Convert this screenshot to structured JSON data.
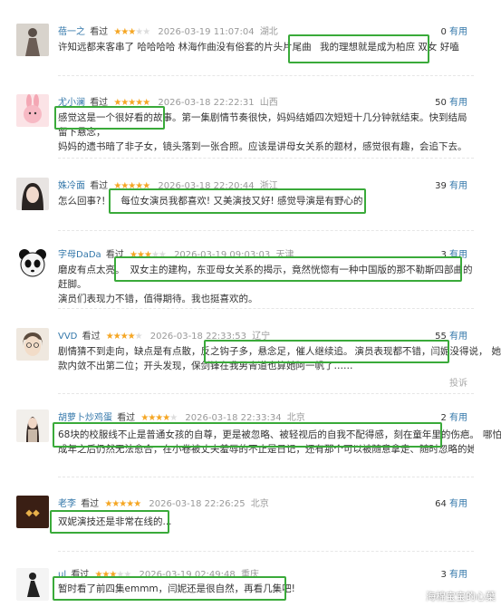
{
  "reviews": [
    {
      "user": "蓓一之",
      "watched": "看过",
      "rating": 3,
      "time": "2026-03-19 11:07:04",
      "location": "湖北",
      "useful_count": "0",
      "useful_label": "有用",
      "line1": "许知远都来客串了 哈哈哈哈 林海作曲没有俗套的片头片尾曲",
      "highlight": "我的理想就是成为柏庶 双女 好嗑"
    },
    {
      "user": "尤小澜",
      "watched": "看过",
      "rating": 5,
      "time": "2026-03-18 22:22:31",
      "location": "山西",
      "useful_count": "50",
      "useful_label": "有用",
      "highlight": "感觉这是一个很好看的故事。",
      "line1": "第一集剧情节奏很快，妈妈结婚四次短短十几分钟就结束。快到结局留下悬念，",
      "line2": "妈妈的遗书暗了非子女，镜头落到一张合照。应该是讲母女关系的题材，感觉很有趣，会追下去。"
    },
    {
      "user": "姝冷面",
      "watched": "看过",
      "rating": 5,
      "time": "2026-03-18 22:20:44",
      "location": "浙江",
      "useful_count": "39",
      "useful_label": "有用",
      "line1": "怎么回事?！",
      "highlight": "每位女演员我都喜欢! 又美演技又好! 感觉导演是有野心的!"
    },
    {
      "user": "字母DaDa",
      "watched": "看过",
      "rating": 3,
      "time": "2026-03-19 09:03:03",
      "location": "天津",
      "useful_count": "3",
      "useful_label": "有用",
      "line1": "磨皮有点太亮。",
      "highlight": "双女主的建构，东亚母女关系的揭示，竟然恍惚有一种中国版的那不勒斯四部曲的赶脚。",
      "line2": "演员们表现力不错，值得期待。我也挺喜欢的。"
    },
    {
      "user": "VVD",
      "watched": "看过",
      "rating": 4,
      "time": "2026-03-18 22:33:53",
      "location": "辽宁",
      "useful_count": "55",
      "useful_label": "有用",
      "line1": "剧情猜不到走向，缺点是有点散，反之钩子多，悬念足，催人继续追。",
      "highlight": "演员表现都不错，闫妮没得说，",
      "line1_tail": "她这",
      "line2": "款内敛不出第二位；开头发现，保剑锋在我男青道也算她阿一帆了……",
      "report": "投诉"
    },
    {
      "user": "胡萝卜炒鸡蛋",
      "watched": "看过",
      "rating": 4,
      "time": "2026-03-18 22:33:34",
      "location": "北京",
      "useful_count": "2",
      "useful_label": "有用",
      "highlight": "68块的校服线不止是普通女孩的自尊，更是被忽略、被轻视后的自我不配得感，刻在童年里的伤疤。",
      "tail": "哪怕",
      "line2": "成年之后仍然无法愈合，在小卷被丈夫羞辱的不止是日记，还有那个可以被随意拿走、随时忽略的她自己"
    },
    {
      "user": "老李",
      "watched": "看过",
      "rating": 5,
      "time": "2026-03-18 22:26:25",
      "location": "北京",
      "useful_count": "64",
      "useful_label": "有用",
      "highlight": "双妮演技还是非常在线的..."
    },
    {
      "user": "ul",
      "watched": "看过",
      "rating": 3,
      "time": "2026-03-19 02:49:48",
      "location": "重庆",
      "useful_count": "3",
      "useful_label": "有用",
      "highlight": "暂时看了前四集emmm，闫妮还是很自然，再看几集吧!"
    }
  ],
  "watermark": "海棉宝宝的心葉"
}
